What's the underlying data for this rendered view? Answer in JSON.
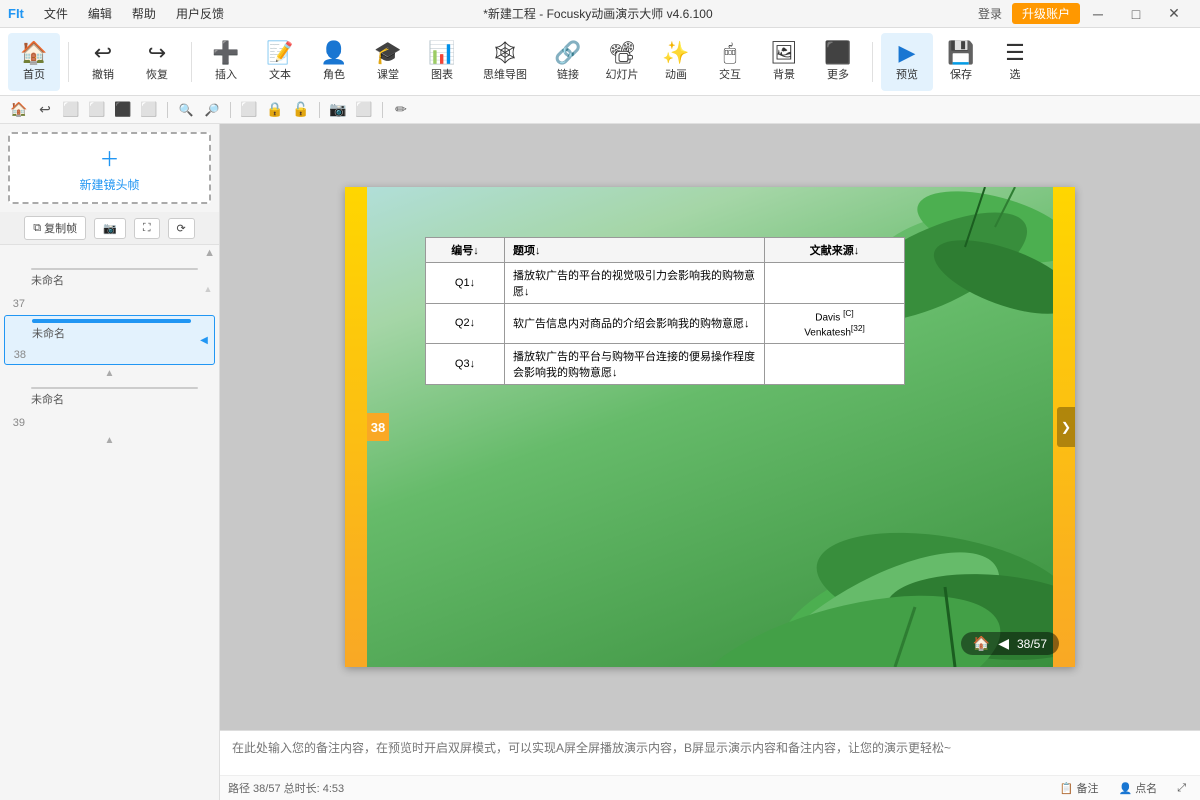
{
  "app": {
    "logo": "FIt",
    "title": "*新建工程 - Focusky动画演示大师 v4.6.100",
    "login_btn": "登录",
    "upgrade_btn": "升级账户"
  },
  "menu": {
    "items": [
      "文件",
      "编辑",
      "帮助",
      "用户反馈"
    ]
  },
  "toolbar": {
    "items": [
      {
        "label": "首页",
        "icon": "🏠"
      },
      {
        "label": "撤销",
        "icon": "↩"
      },
      {
        "label": "恢复",
        "icon": "↪"
      },
      {
        "label": "插入",
        "icon": "➕"
      },
      {
        "label": "文本",
        "icon": "🔤"
      },
      {
        "label": "角色",
        "icon": "👤"
      },
      {
        "label": "课堂",
        "icon": "🎓"
      },
      {
        "label": "图表",
        "icon": "📊"
      },
      {
        "label": "思维导图",
        "icon": "🕸"
      },
      {
        "label": "链接",
        "icon": "🔗"
      },
      {
        "label": "幻灯片",
        "icon": "📽"
      },
      {
        "label": "动画",
        "icon": "✨"
      },
      {
        "label": "交互",
        "icon": "🖱"
      },
      {
        "label": "背景",
        "icon": "🖼"
      },
      {
        "label": "更多",
        "icon": "⋯"
      },
      {
        "label": "预览",
        "icon": "▶"
      },
      {
        "label": "保存",
        "icon": "💾"
      },
      {
        "label": "选",
        "icon": "☰"
      }
    ]
  },
  "subtoolbar": {
    "buttons": [
      "🏠",
      "↩",
      "⬜",
      "⬜",
      "🔍+",
      "🔍-",
      "⬜",
      "🔒",
      "⬜",
      "📷",
      "⬜",
      "✏"
    ]
  },
  "left_panel": {
    "new_frame_label": "新建镜头帧",
    "copy_btn": "复制帧",
    "camera_btn": "",
    "expand_btn": "",
    "more_btn": "",
    "slides": [
      {
        "num": "37",
        "label": "未命名",
        "selected": false
      },
      {
        "num": "38",
        "label": "未命名",
        "selected": true
      },
      {
        "num": "39",
        "label": "未命名",
        "selected": false
      }
    ]
  },
  "canvas": {
    "badge_num": "38",
    "table": {
      "headers": [
        "编号↓",
        "题项↓",
        "文献来源↓"
      ],
      "rows": [
        {
          "num": "Q1↓",
          "content": "播放软广告的平台的视觉吸引力会影响我的购物意愿↓",
          "ref": ""
        },
        {
          "num": "Q2↓",
          "content": "软广告信息内对商品的介绍会影响我的购物意愿↓",
          "ref": "Davis [C]↓ Venkatesh[32]↓"
        },
        {
          "num": "Q3↓",
          "content": "播放软广告的平台与购物平台连接的便易操作程度会影响我的购物意愿↓",
          "ref": ""
        }
      ]
    },
    "nav": {
      "page": "38/57"
    }
  },
  "notes": {
    "placeholder": "在此处输入您的备注内容，在预览时开启双屏模式，可以实现A屏全屏播放演示内容，B屏显示演示内容和备注内容，让您的演示更轻松~"
  },
  "footer": {
    "path": "路径 38/57  总时长: 4:53",
    "notes_btn": "备注",
    "points_btn": "点名"
  }
}
